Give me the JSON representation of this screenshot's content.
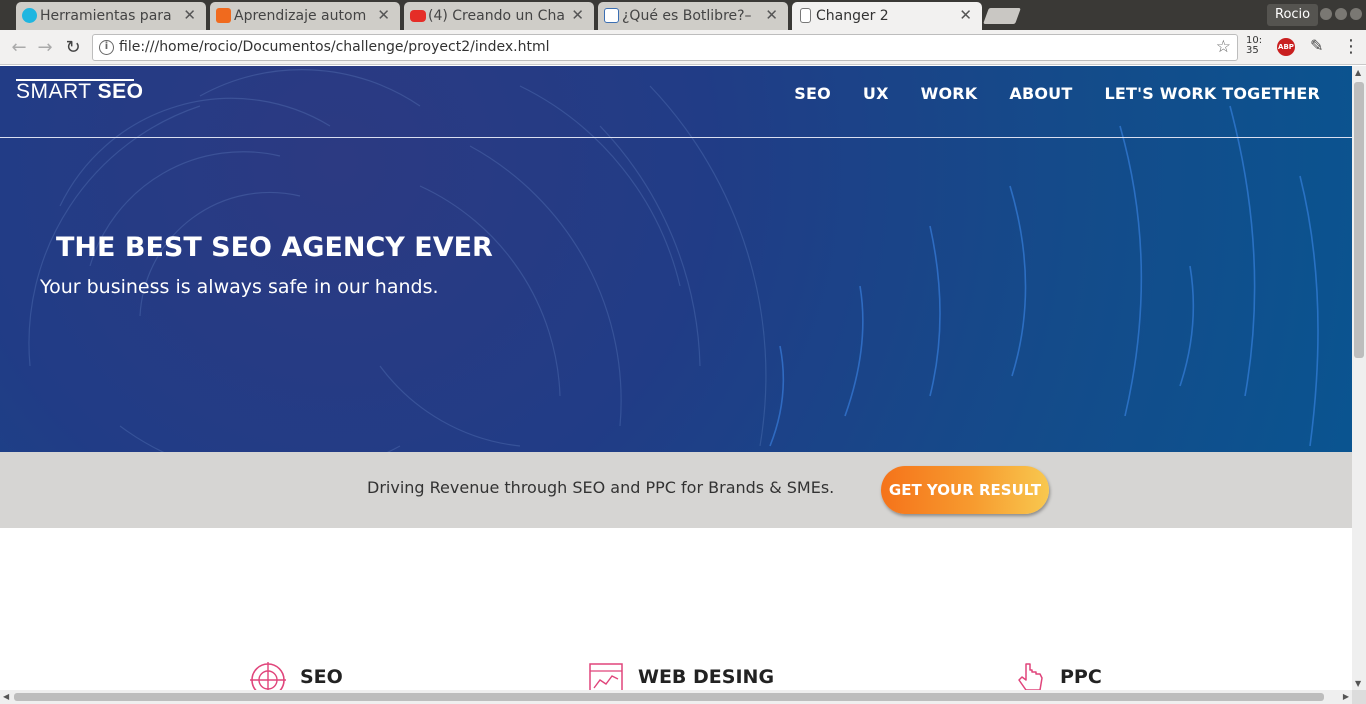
{
  "browser": {
    "tabs": [
      {
        "title": "Herramientas para",
        "icon": "bot-icon",
        "color": "#1fb6e0"
      },
      {
        "title": "Aprendizaje autom",
        "icon": "cube-icon",
        "color": "#f06a1e"
      },
      {
        "title": "(4) Creando un Cha",
        "icon": "youtube-icon",
        "color": "#e52d27"
      },
      {
        "title": "¿Qué es Botlibre?–",
        "icon": "page-icon",
        "color": "#3b6fb3"
      },
      {
        "title": "Changer 2",
        "icon": "document-icon",
        "color": "#777777"
      }
    ],
    "profile": "Rocio",
    "url": "file:///home/rocio/Documentos/challenge/proyect2/index.html",
    "extension_time": "10:\n35",
    "abp_label": "ABP"
  },
  "site": {
    "logo_light": "SMART",
    "logo_bold": "SEO",
    "nav": [
      "SEO",
      "UX",
      "WORK",
      "ABOUT",
      "LET'S WORK TOGETHER"
    ],
    "hero_title": "THE BEST SEO AGENCY EVER",
    "hero_subtitle": "Your business is always safe in our hands.",
    "tagline": "Driving Revenue through SEO and PPC for Brands & SMEs.",
    "cta_label": "GET YOUR RESULT",
    "services": [
      {
        "label": "SEO",
        "icon": "target-icon"
      },
      {
        "label": "WEB DESING",
        "icon": "chart-icon"
      },
      {
        "label": "PPC",
        "icon": "pointer-icon"
      }
    ],
    "colors": {
      "hero_start": "#2c3a82",
      "hero_end": "#0a5490",
      "band": "#d6d5d3",
      "cta_start": "#f5731a",
      "cta_end": "#f8c84f",
      "icon_accent": "#e0457b"
    }
  }
}
